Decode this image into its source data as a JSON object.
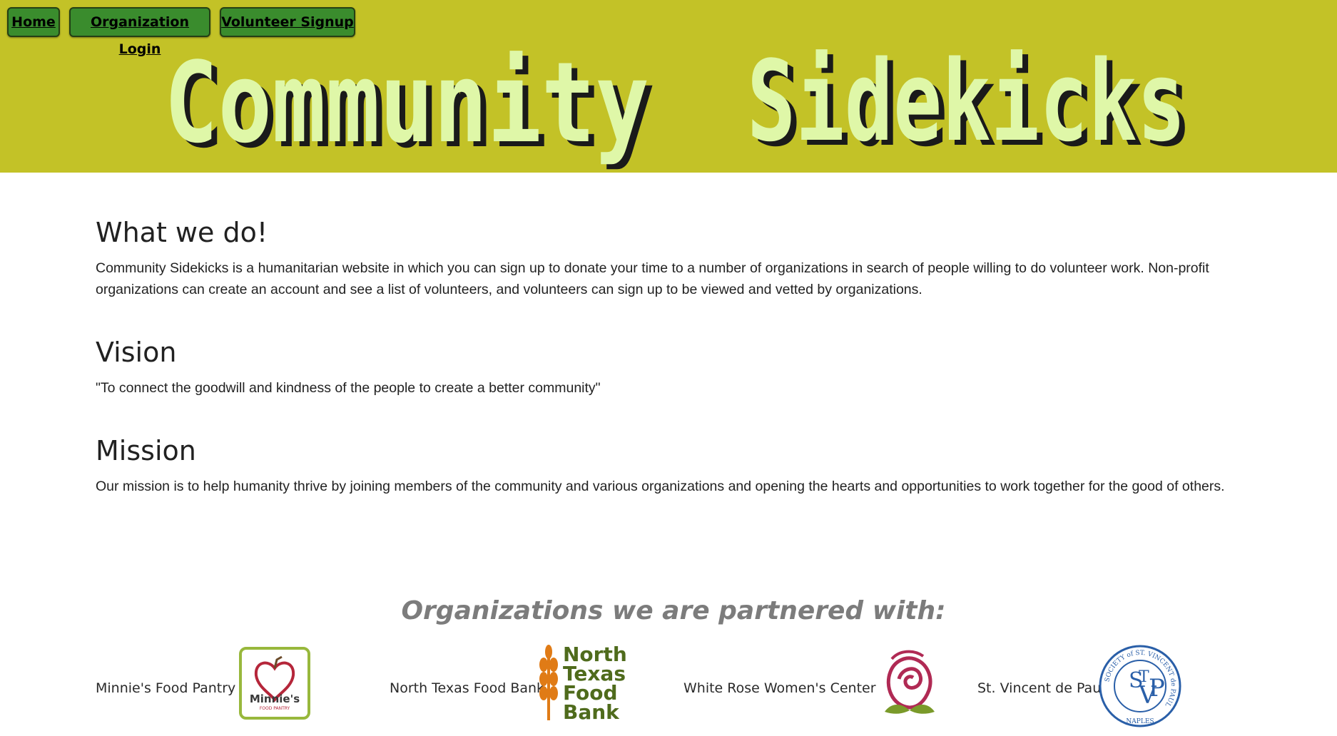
{
  "nav": {
    "home_label": "Home",
    "org_login_label": "Organization Login",
    "volunteer_signup_label": "Volunteer Signup"
  },
  "brand": {
    "title_word1": "Community",
    "title_word2": "Sidekicks",
    "banner_color": "#c3c227",
    "title_color": "#dff7a8",
    "nav_button_color": "#3a8c2d"
  },
  "sections": {
    "what_we_do": {
      "heading": "What we do!",
      "text": "Community Sidekicks is a humanitarian website in which you can sign up to donate your time to a number of organizations in search of people willing to do volunteer work. Non-profit organizations can create an account and see a list of volunteers, and volunteers can sign up to be viewed and vetted by organizations."
    },
    "vision": {
      "heading": "Vision",
      "text": "\"To connect the goodwill and kindness of the people to create a better community\""
    },
    "mission": {
      "heading": "Mission",
      "text": "Our mission is to help humanity thrive by joining members of the community and various organizations and opening the hearts and opportunities to work together for the good of others."
    }
  },
  "partners": {
    "heading": "Organizations we are partnered with:",
    "items": [
      {
        "name": "Minnie's Food Pantry",
        "logo_icon": "minnies-apple-heart-logo",
        "logo_text": "Minnie's",
        "logo_subtext": "FOOD PANTRY"
      },
      {
        "name": "North Texas Food Bank",
        "logo_icon": "wheat-logo",
        "logo_line1": "North",
        "logo_line2": "Texas",
        "logo_line3": "Food",
        "logo_line4": "Bank"
      },
      {
        "name": "White Rose Women's Center",
        "logo_icon": "rose-logo"
      },
      {
        "name": "St. Vincent de Paul",
        "logo_icon": "svdp-seal-logo",
        "logo_ring_text": "SOCIETY of ST. VINCENT de PAUL",
        "logo_bottom_text": "NAPLES"
      }
    ]
  }
}
